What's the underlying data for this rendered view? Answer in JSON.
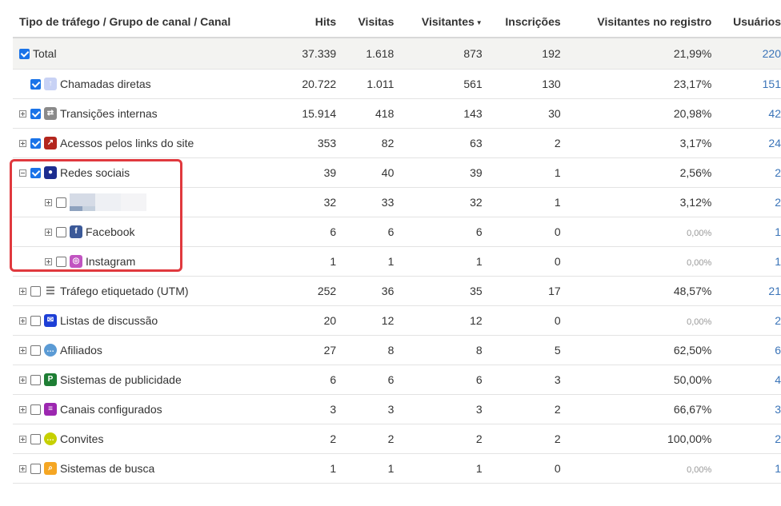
{
  "columns": {
    "name": "Tipo de tráfego / Grupo de canal / Canal",
    "hits": "Hits",
    "visitas": "Visitas",
    "visitantes": "Visitantes",
    "inscricoes": "Inscrições",
    "registro": "Visitantes no registro",
    "usuarios": "Usuários"
  },
  "rows": {
    "total": {
      "label": "Total",
      "hits": "37.339",
      "visitas": "1.618",
      "visitantes": "873",
      "inscricoes": "192",
      "registro": "21,99%",
      "usuarios": "220"
    },
    "chamadas": {
      "label": "Chamadas diretas",
      "hits": "20.722",
      "visitas": "1.011",
      "visitantes": "561",
      "inscricoes": "130",
      "registro": "23,17%",
      "usuarios": "151"
    },
    "transicoes": {
      "label": "Transições internas",
      "hits": "15.914",
      "visitas": "418",
      "visitantes": "143",
      "inscricoes": "30",
      "registro": "20,98%",
      "usuarios": "42"
    },
    "acessos": {
      "label": "Acessos pelos links do site",
      "hits": "353",
      "visitas": "82",
      "visitantes": "63",
      "inscricoes": "2",
      "registro": "3,17%",
      "usuarios": "24"
    },
    "redes": {
      "label": "Redes sociais",
      "hits": "39",
      "visitas": "40",
      "visitantes": "39",
      "inscricoes": "1",
      "registro": "2,56%",
      "usuarios": "2"
    },
    "blurred": {
      "label": "",
      "hits": "32",
      "visitas": "33",
      "visitantes": "32",
      "inscricoes": "1",
      "registro": "3,12%",
      "usuarios": "2"
    },
    "facebook": {
      "label": "Facebook",
      "hits": "6",
      "visitas": "6",
      "visitantes": "6",
      "inscricoes": "0",
      "registro": "0,00%",
      "usuarios": "1"
    },
    "instagram": {
      "label": "Instagram",
      "hits": "1",
      "visitas": "1",
      "visitantes": "1",
      "inscricoes": "0",
      "registro": "0,00%",
      "usuarios": "1"
    },
    "utm": {
      "label": "Tráfego etiquetado (UTM)",
      "hits": "252",
      "visitas": "36",
      "visitantes": "35",
      "inscricoes": "17",
      "registro": "48,57%",
      "usuarios": "21"
    },
    "listas": {
      "label": "Listas de discussão",
      "hits": "20",
      "visitas": "12",
      "visitantes": "12",
      "inscricoes": "0",
      "registro": "0,00%",
      "usuarios": "2"
    },
    "afiliados": {
      "label": "Afiliados",
      "hits": "27",
      "visitas": "8",
      "visitantes": "8",
      "inscricoes": "5",
      "registro": "62,50%",
      "usuarios": "6"
    },
    "publicidade": {
      "label": "Sistemas de publicidade",
      "hits": "6",
      "visitas": "6",
      "visitantes": "6",
      "inscricoes": "3",
      "registro": "50,00%",
      "usuarios": "4"
    },
    "configurados": {
      "label": "Canais configurados",
      "hits": "3",
      "visitas": "3",
      "visitantes": "3",
      "inscricoes": "2",
      "registro": "66,67%",
      "usuarios": "3"
    },
    "convites": {
      "label": "Convites",
      "hits": "2",
      "visitas": "2",
      "visitantes": "2",
      "inscricoes": "2",
      "registro": "100,00%",
      "usuarios": "2"
    },
    "busca": {
      "label": "Sistemas de busca",
      "hits": "1",
      "visitas": "1",
      "visitantes": "1",
      "inscricoes": "0",
      "registro": "0,00%",
      "usuarios": "1"
    }
  },
  "colors": {
    "link": "#3b74b8",
    "checkbox": "#1a73e8",
    "highlight": "#e0393e"
  }
}
